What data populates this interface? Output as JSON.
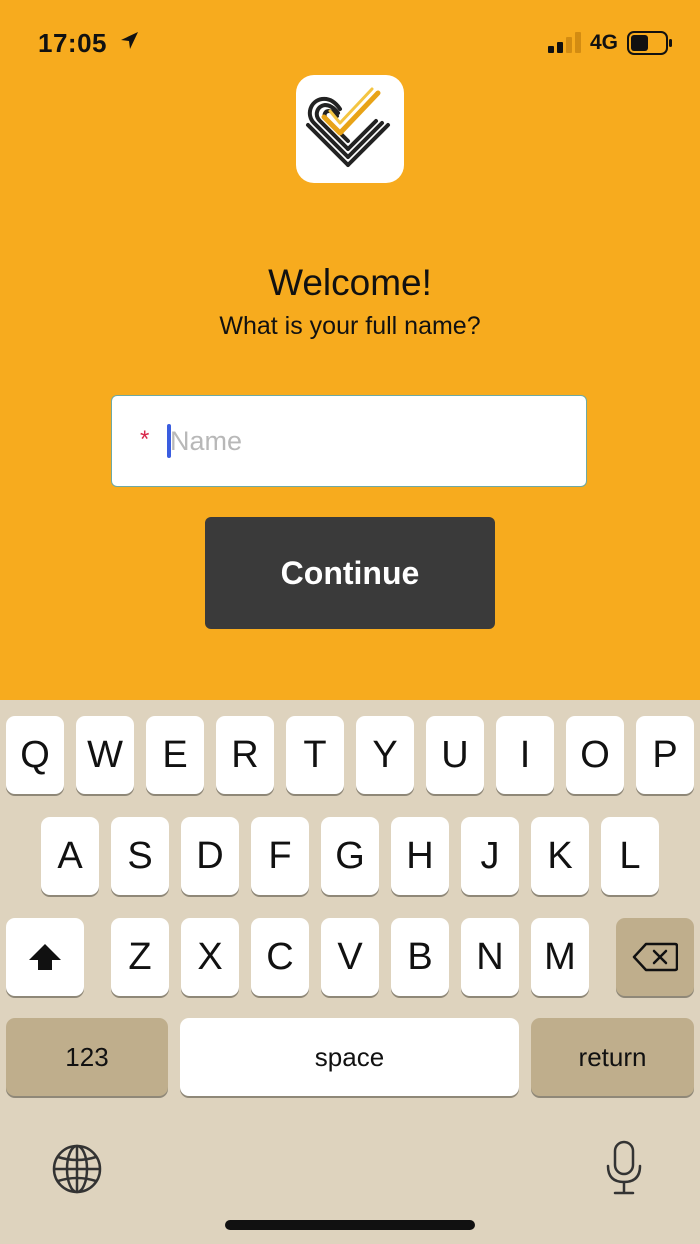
{
  "status_bar": {
    "time": "17:05",
    "network": "4G",
    "icons": [
      "location-arrow-icon",
      "signal-bars-icon",
      "battery-icon"
    ]
  },
  "app": {
    "icon": "heart-check-logo-icon",
    "brand_color": "#f7ab1e"
  },
  "welcome": {
    "title": "Welcome!",
    "subtitle": "What is your full name?"
  },
  "form": {
    "required_mark": "*",
    "name_placeholder": "Name",
    "name_value": "",
    "continue_label": "Continue"
  },
  "keyboard": {
    "row1": [
      "Q",
      "W",
      "E",
      "R",
      "T",
      "Y",
      "U",
      "I",
      "O",
      "P"
    ],
    "row2": [
      "A",
      "S",
      "D",
      "F",
      "G",
      "H",
      "J",
      "K",
      "L"
    ],
    "row3": [
      "Z",
      "X",
      "C",
      "V",
      "B",
      "N",
      "M"
    ],
    "numbers_label": "123",
    "space_label": "space",
    "return_label": "return",
    "icons": [
      "shift-icon",
      "backspace-icon",
      "globe-icon",
      "microphone-icon"
    ]
  }
}
